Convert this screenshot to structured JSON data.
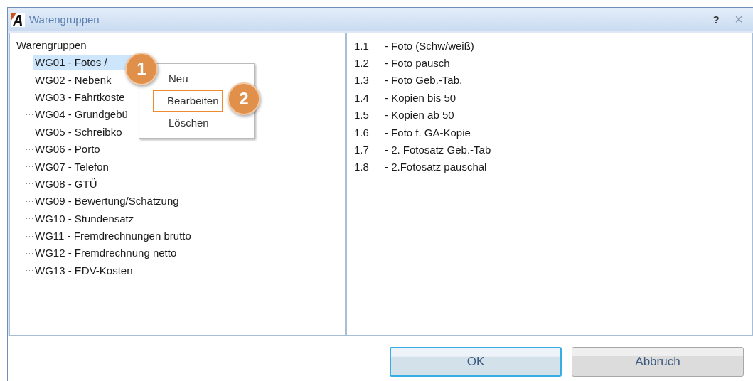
{
  "window": {
    "title": "Warengruppen",
    "help": "?",
    "close": "×"
  },
  "tree": {
    "label": "Warengruppen",
    "children": [
      {
        "label": "WG01 - Fotos /",
        "selected": true
      },
      {
        "label": "WG02 - Nebenk",
        "selected": false
      },
      {
        "label": "WG03 - Fahrtkoste",
        "selected": false
      },
      {
        "label": "WG04 - Grundgebü",
        "selected": false
      },
      {
        "label": "WG05 - Schreibko",
        "selected": false
      },
      {
        "label": "WG06 - Porto",
        "selected": false
      },
      {
        "label": "WG07 - Telefon",
        "selected": false
      },
      {
        "label": "WG08 - GTÜ",
        "selected": false
      },
      {
        "label": "WG09 - Bewertung/Schätzung",
        "selected": false
      },
      {
        "label": "WG10 - Stundensatz",
        "selected": false
      },
      {
        "label": "WG11 - Fremdrechnungen brutto",
        "selected": false
      },
      {
        "label": "WG12 - Fremdrechnung netto",
        "selected": false
      },
      {
        "label": "WG13 - EDV-Kosten",
        "selected": false
      }
    ]
  },
  "items": [
    {
      "number": "1.1",
      "name": "- Foto (Schw/weiß)"
    },
    {
      "number": "1.2",
      "name": "- Foto pausch"
    },
    {
      "number": "1.3",
      "name": "- Foto Geb.-Tab."
    },
    {
      "number": "1.4",
      "name": "- Kopien bis 50"
    },
    {
      "number": "1.5",
      "name": "- Kopien ab 50"
    },
    {
      "number": "1.6",
      "name": "- Foto f. GA-Kopie"
    },
    {
      "number": "1.7",
      "name": "- 2. Fotosatz Geb.-Tab"
    },
    {
      "number": "1.8",
      "name": "- 2.Fotosatz pauschal"
    }
  ],
  "context_menu": [
    {
      "label": "Neu",
      "highlighted": false
    },
    {
      "label": "Bearbeiten",
      "highlighted": true
    },
    {
      "label": "Löschen",
      "highlighted": false
    }
  ],
  "callouts": [
    "1",
    "2"
  ],
  "buttons": [
    {
      "label": "OK",
      "default": true
    },
    {
      "label": "Abbruch",
      "default": false
    }
  ]
}
